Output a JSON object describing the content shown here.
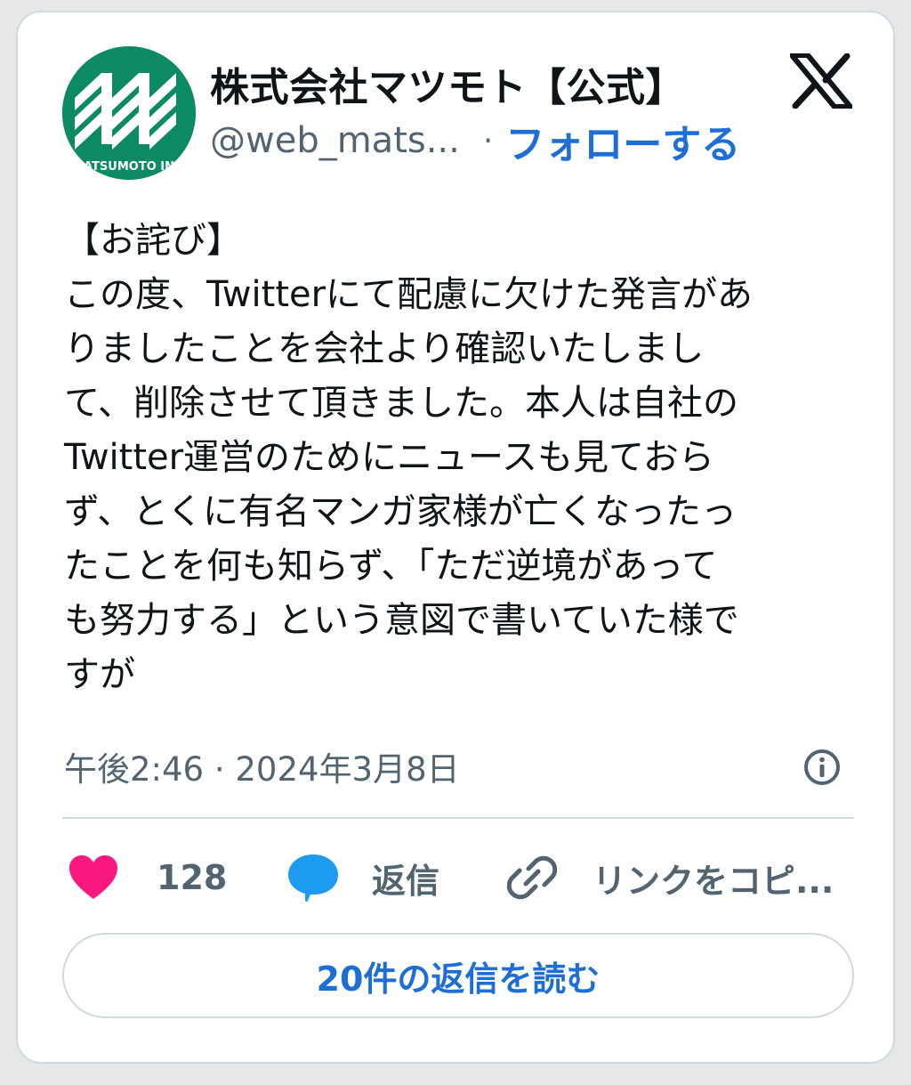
{
  "account": {
    "display_name": "株式会社マツモト【公式】",
    "handle": "@web_mats...",
    "separator": "·",
    "follow_label": "フォローする",
    "avatar_text": "ATSUMOTO IN"
  },
  "tweet": {
    "lines": [
      "【お詫び】",
      "この度、Twitterにて配慮に欠けた発言があ",
      "りましたことを会社より確認いたしまし",
      "て、削除させて頂きました。本人は自社の",
      "Twitter運営のためにニュースも見ておら",
      "ず、とくに有名マンガ家様が亡くなったっ",
      "たことを何も知らず、「ただ逆境があって",
      "も努力する」という意図で書いていた様で",
      "すが"
    ],
    "timestamp": "午後2:46 · 2024年3月8日"
  },
  "actions": {
    "like_count": "128",
    "reply_label": "返信",
    "copy_link_label": "リンクをコピ..."
  },
  "read_replies_label": "20件の返信を読む",
  "colors": {
    "accent": "#1d6fd6",
    "like": "#f91880",
    "reply_bubble": "#1d9bf0",
    "avatar_bg": "#0b8a63"
  },
  "icons": [
    "x-logo-icon",
    "info-icon",
    "heart-icon",
    "reply-bubble-icon",
    "link-icon"
  ]
}
